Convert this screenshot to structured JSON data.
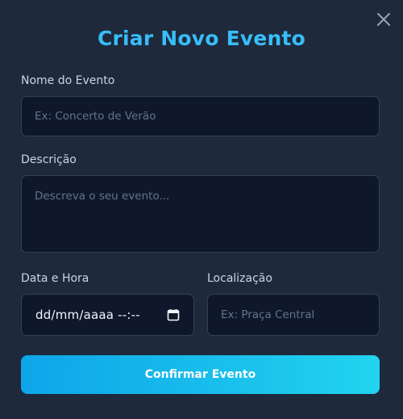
{
  "modal": {
    "title": "Criar Novo Evento",
    "close_icon": "close-icon"
  },
  "form": {
    "name": {
      "label": "Nome do Evento",
      "placeholder": "Ex: Concerto de Verão",
      "value": ""
    },
    "description": {
      "label": "Descrição",
      "placeholder": "Descreva o seu evento...",
      "value": ""
    },
    "datetime": {
      "label": "Data e Hora",
      "display_value": "dd/mm/aaaa --:--",
      "icon": "calendar-icon"
    },
    "location": {
      "label": "Localização",
      "placeholder": "Ex: Praça Central",
      "value": ""
    },
    "submit_label": "Confirmar Evento"
  },
  "colors": {
    "background": "#1e293b",
    "title": "#38bdf8",
    "input_bg": "#0f172a",
    "button_gradient_start": "#0ea5e9",
    "button_gradient_end": "#22d3ee"
  }
}
